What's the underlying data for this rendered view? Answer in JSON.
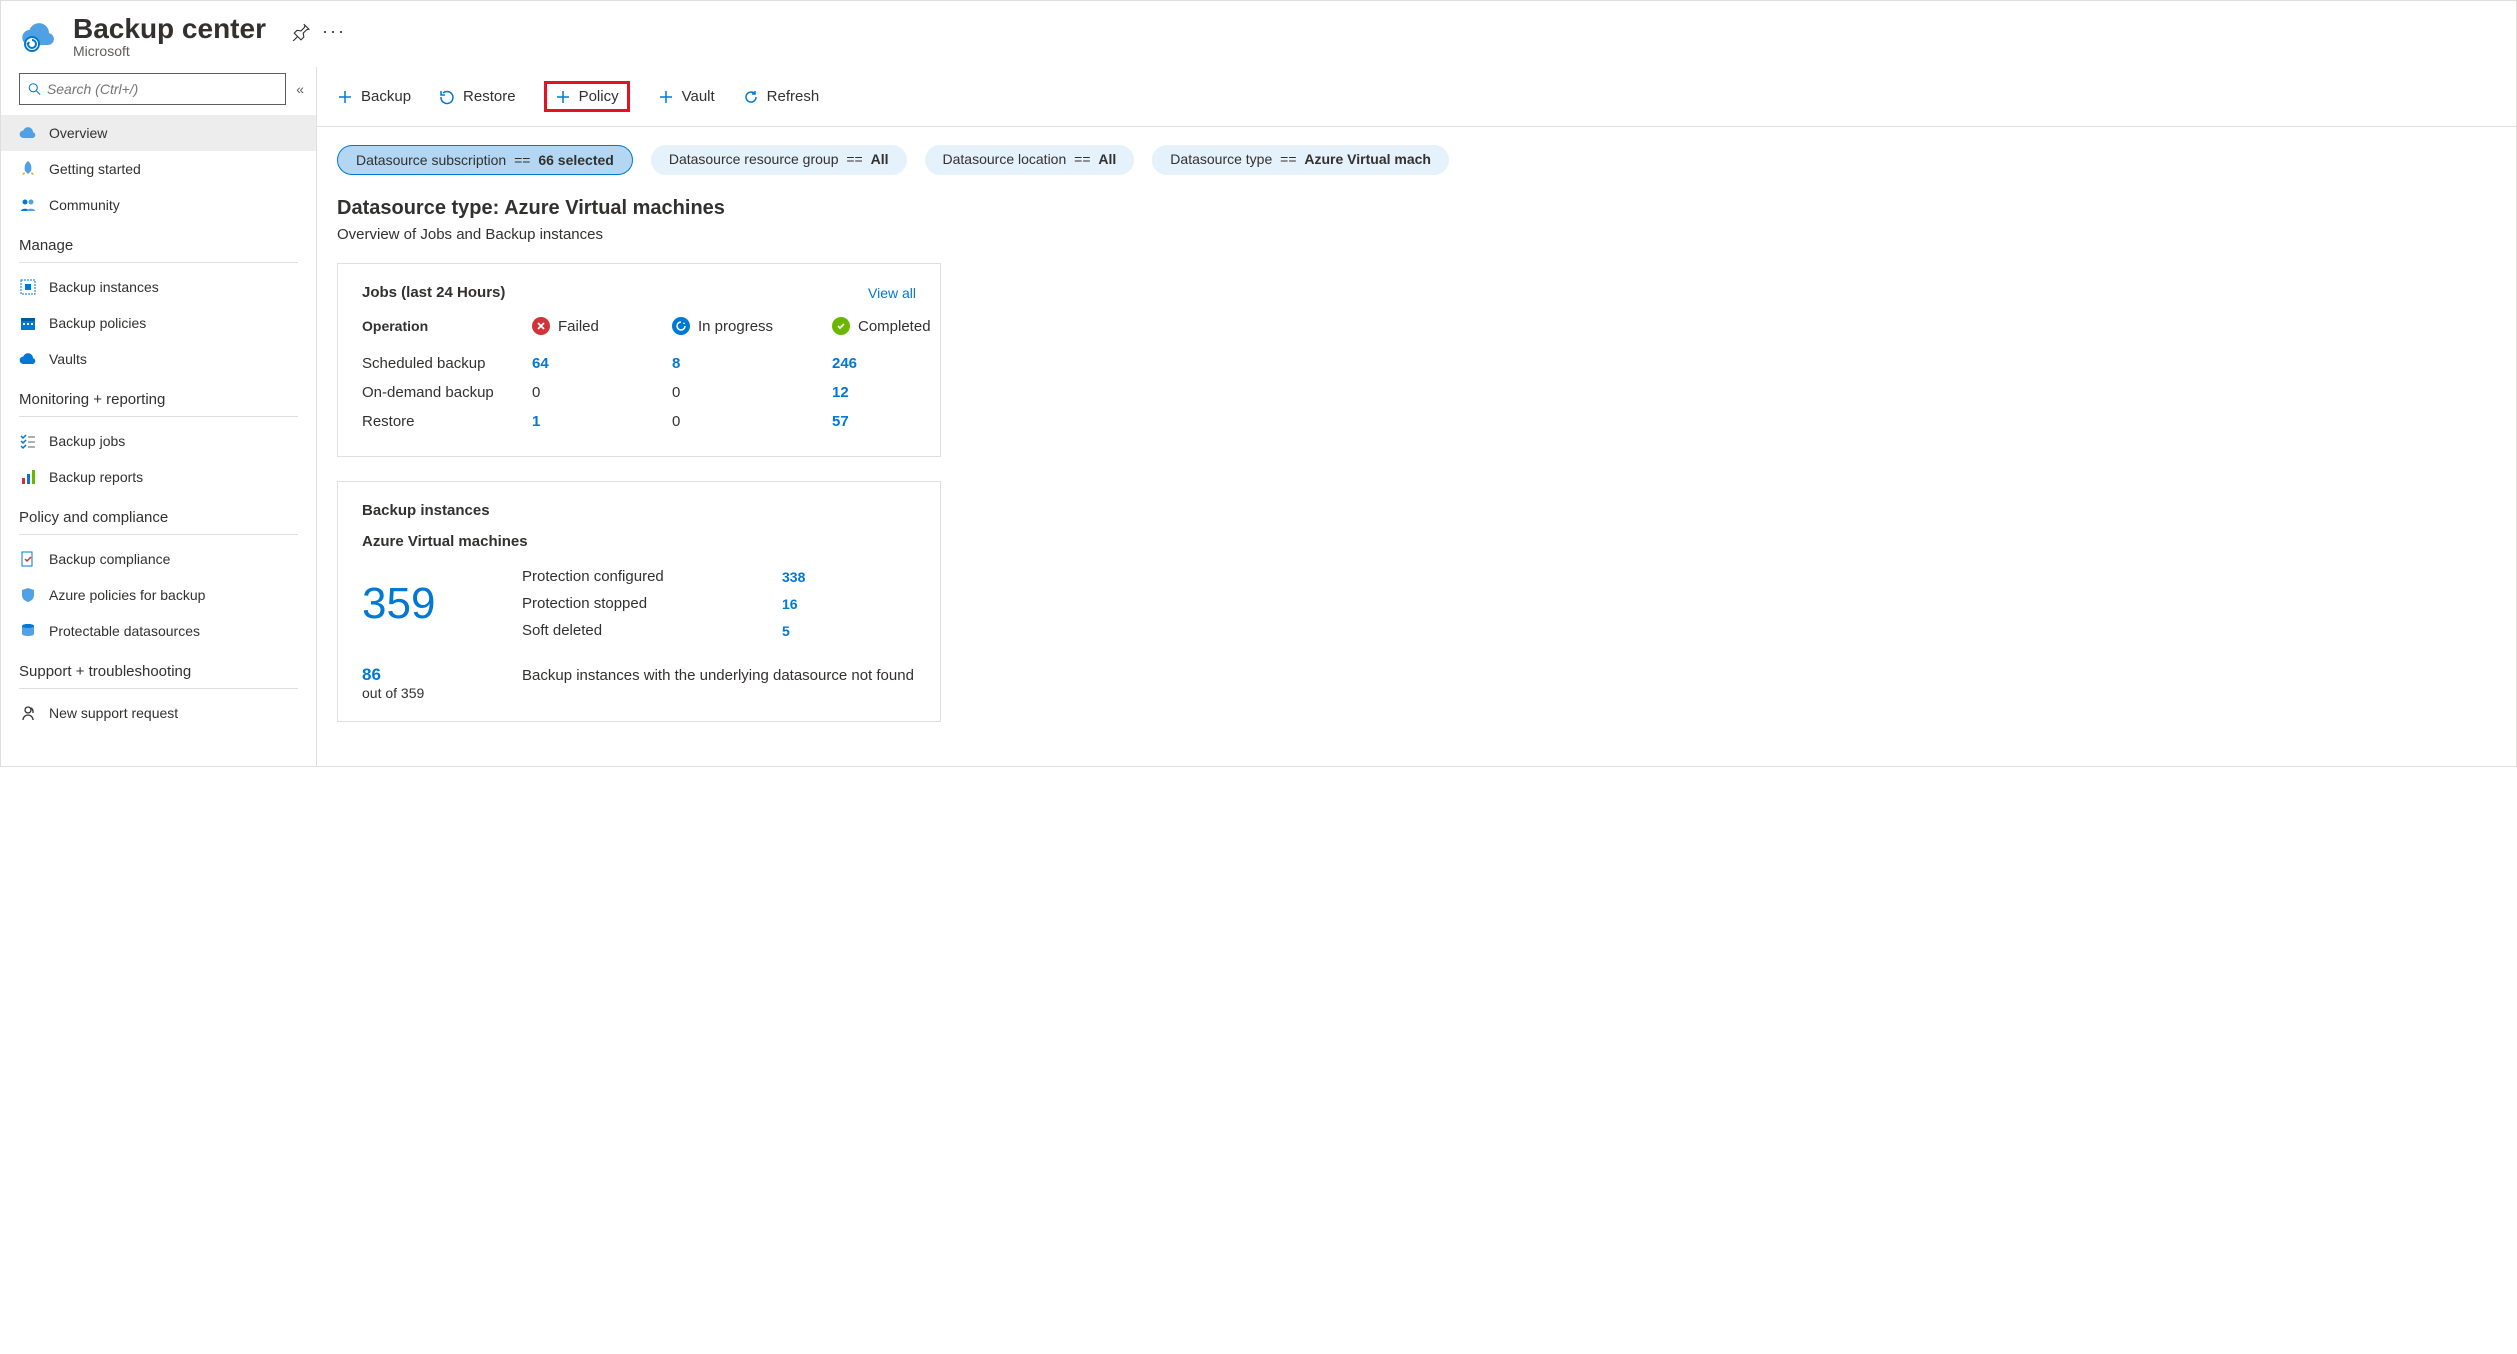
{
  "header": {
    "title": "Backup center",
    "subtitle": "Microsoft"
  },
  "search": {
    "placeholder": "Search (Ctrl+/)"
  },
  "sidebar": {
    "overview": "Overview",
    "getting_started": "Getting started",
    "community": "Community",
    "sections": {
      "manage": "Manage",
      "monitoring": "Monitoring + reporting",
      "policy": "Policy and compliance",
      "support": "Support + troubleshooting"
    },
    "manage_items": {
      "instances": "Backup instances",
      "policies": "Backup policies",
      "vaults": "Vaults"
    },
    "monitoring_items": {
      "jobs": "Backup jobs",
      "reports": "Backup reports"
    },
    "policy_items": {
      "compliance": "Backup compliance",
      "azure_policies": "Azure policies for backup",
      "protectable": "Protectable datasources"
    },
    "support_items": {
      "new_request": "New support request"
    }
  },
  "toolbar": {
    "backup": "Backup",
    "restore": "Restore",
    "policy": "Policy",
    "vault": "Vault",
    "refresh": "Refresh"
  },
  "filters": {
    "subscription": {
      "label": "Datasource subscription",
      "op": "==",
      "value": "66 selected"
    },
    "rg": {
      "label": "Datasource resource group",
      "op": "==",
      "value": "All"
    },
    "location": {
      "label": "Datasource location",
      "op": "==",
      "value": "All"
    },
    "type": {
      "label": "Datasource type",
      "op": "==",
      "value": "Azure Virtual mach"
    }
  },
  "content": {
    "title": "Datasource type: Azure Virtual machines",
    "subtitle": "Overview of Jobs and Backup instances"
  },
  "jobs_card": {
    "title": "Jobs (last 24 Hours)",
    "view_all": "View all",
    "head_op": "Operation",
    "head_failed": "Failed",
    "head_progress": "In progress",
    "head_completed": "Completed",
    "rows": [
      {
        "op": "Scheduled backup",
        "failed": "64",
        "progress": "8",
        "completed": "246"
      },
      {
        "op": "On-demand backup",
        "failed": "0",
        "progress": "0",
        "completed": "12"
      },
      {
        "op": "Restore",
        "failed": "1",
        "progress": "0",
        "completed": "57"
      }
    ]
  },
  "instances_card": {
    "title": "Backup instances",
    "subtitle": "Azure Virtual machines",
    "total": "359",
    "rows": [
      {
        "label": "Protection configured",
        "value": "338"
      },
      {
        "label": "Protection stopped",
        "value": "16"
      },
      {
        "label": "Soft deleted",
        "value": "5"
      }
    ],
    "not_found_count": "86",
    "not_found_out_of": "out of 359",
    "not_found_text": "Backup instances with the underlying datasource not found"
  }
}
